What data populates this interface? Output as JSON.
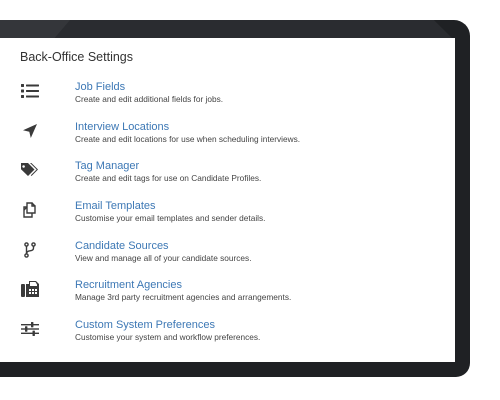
{
  "panel": {
    "title": "Back-Office Settings"
  },
  "colors": {
    "link": "#3d78b5",
    "icon": "#3a3a3a",
    "bezel": "#1f2124",
    "text": "#444444"
  },
  "settings": [
    {
      "title": "Job Fields",
      "description": "Create and edit additional fields for jobs.",
      "icon": "list-icon"
    },
    {
      "title": "Interview Locations",
      "description": "Create and edit locations for use when scheduling interviews.",
      "icon": "location-arrow-icon"
    },
    {
      "title": "Tag Manager",
      "description": "Create and edit tags for use on Candidate Profiles.",
      "icon": "tags-icon"
    },
    {
      "title": "Email Templates",
      "description": "Customise your email templates and sender details.",
      "icon": "copy-icon"
    },
    {
      "title": "Candidate Sources",
      "description": "View and manage all of your candidate sources.",
      "icon": "code-fork-icon"
    },
    {
      "title": "Recruitment Agencies",
      "description": "Manage 3rd party recruitment agencies and arrangements.",
      "icon": "fax-icon"
    },
    {
      "title": "Custom System Preferences",
      "description": "Customise your system and workflow preferences.",
      "icon": "sliders-icon"
    }
  ]
}
